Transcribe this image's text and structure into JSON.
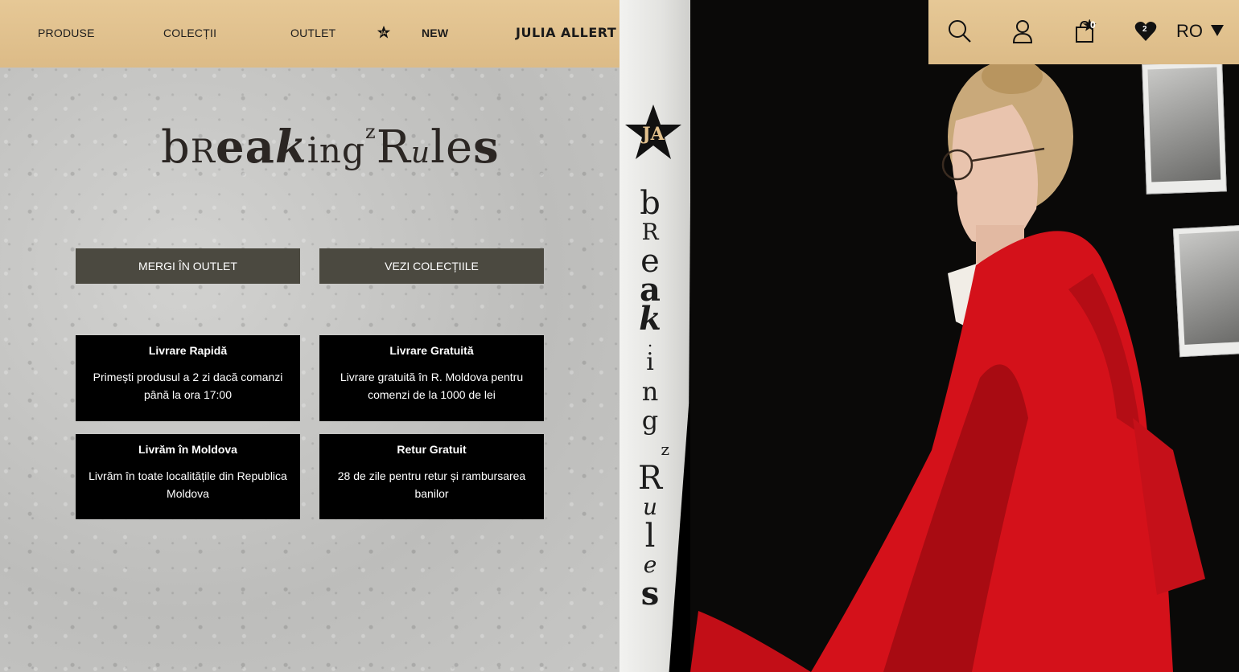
{
  "nav": {
    "items": [
      {
        "label": "PRODUSE"
      },
      {
        "label": "COLECȚII"
      },
      {
        "label": "OUTLET"
      },
      {
        "label": "NEW"
      }
    ],
    "star_icon": "star-ja-icon",
    "brand": "JULIA ALLERT"
  },
  "hero": {
    "slogan_parts": [
      "b",
      "R",
      "e",
      "a",
      "k",
      "i",
      "n",
      "g",
      "z",
      "R",
      "u",
      "l",
      "e",
      "s"
    ],
    "buttons": {
      "outlet": "MERGI ÎN OUTLET",
      "collections": "VEZI COLECȚIILE"
    },
    "features": [
      {
        "title": "Livrare Rapidă",
        "text": "Primești produsul a 2 zi dacă comanzi până la ora 17:00"
      },
      {
        "title": "Livrare Gratuită",
        "text": "Livrare gratuită în R. Moldova pentru comenzi de la 1000 de lei"
      },
      {
        "title": "Livrăm în Moldova",
        "text": "Livrăm în toate localitățile din Republica Moldova"
      },
      {
        "title": "Retur Gratuit",
        "text": "28 de zile pentru retur și rambursarea banilor"
      }
    ]
  },
  "strip": {
    "logo": "JA",
    "letters": [
      "b",
      "R",
      "e",
      "a",
      "k",
      ".",
      "i",
      "n",
      "g",
      "z",
      "R",
      "u",
      "l",
      "e",
      "s"
    ]
  },
  "header_right": {
    "cart_count": "0",
    "wishlist_count": "2",
    "language": "RO"
  },
  "colors": {
    "kraft": "#e2c18d",
    "button_bg": "#4b4940",
    "red": "#d4111a"
  }
}
